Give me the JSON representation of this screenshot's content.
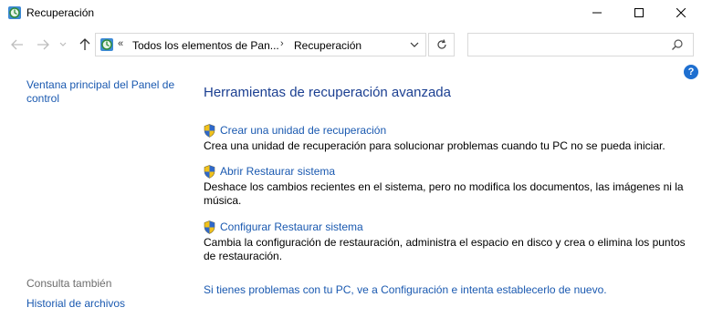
{
  "window": {
    "title": "Recuperación",
    "icon": "control-panel-recovery-icon"
  },
  "address_bar": {
    "overflow": "«",
    "breadcrumbs": [
      "Todos los elementos de Pan...",
      "Recuperación"
    ],
    "separator": "›"
  },
  "search": {
    "placeholder": "",
    "value": ""
  },
  "sidebar": {
    "home_link": "Ventana principal del Panel de control",
    "see_also_label": "Consulta también",
    "see_also_links": [
      "Historial de archivos"
    ]
  },
  "main": {
    "heading": "Herramientas de recuperación avanzada",
    "tasks": [
      {
        "link": "Crear una unidad de recuperación",
        "description": "Crea una unidad de recuperación para solucionar problemas cuando tu PC no se pueda iniciar."
      },
      {
        "link": "Abrir Restaurar sistema",
        "description": "Deshace los cambios recientes en el sistema, pero no modifica los documentos, las imágenes ni la música."
      },
      {
        "link": "Configurar Restaurar sistema",
        "description": "Cambia la configuración de restauración, administra el espacio en disco y crea o elimina los puntos de restauración."
      }
    ],
    "bottom_link": "Si tienes problemas con tu PC, ve a Configuración e intenta establecerlo de nuevo."
  },
  "colors": {
    "link": "#1a59b0",
    "heading": "#1b3f91",
    "muted": "#6d6d6d"
  }
}
